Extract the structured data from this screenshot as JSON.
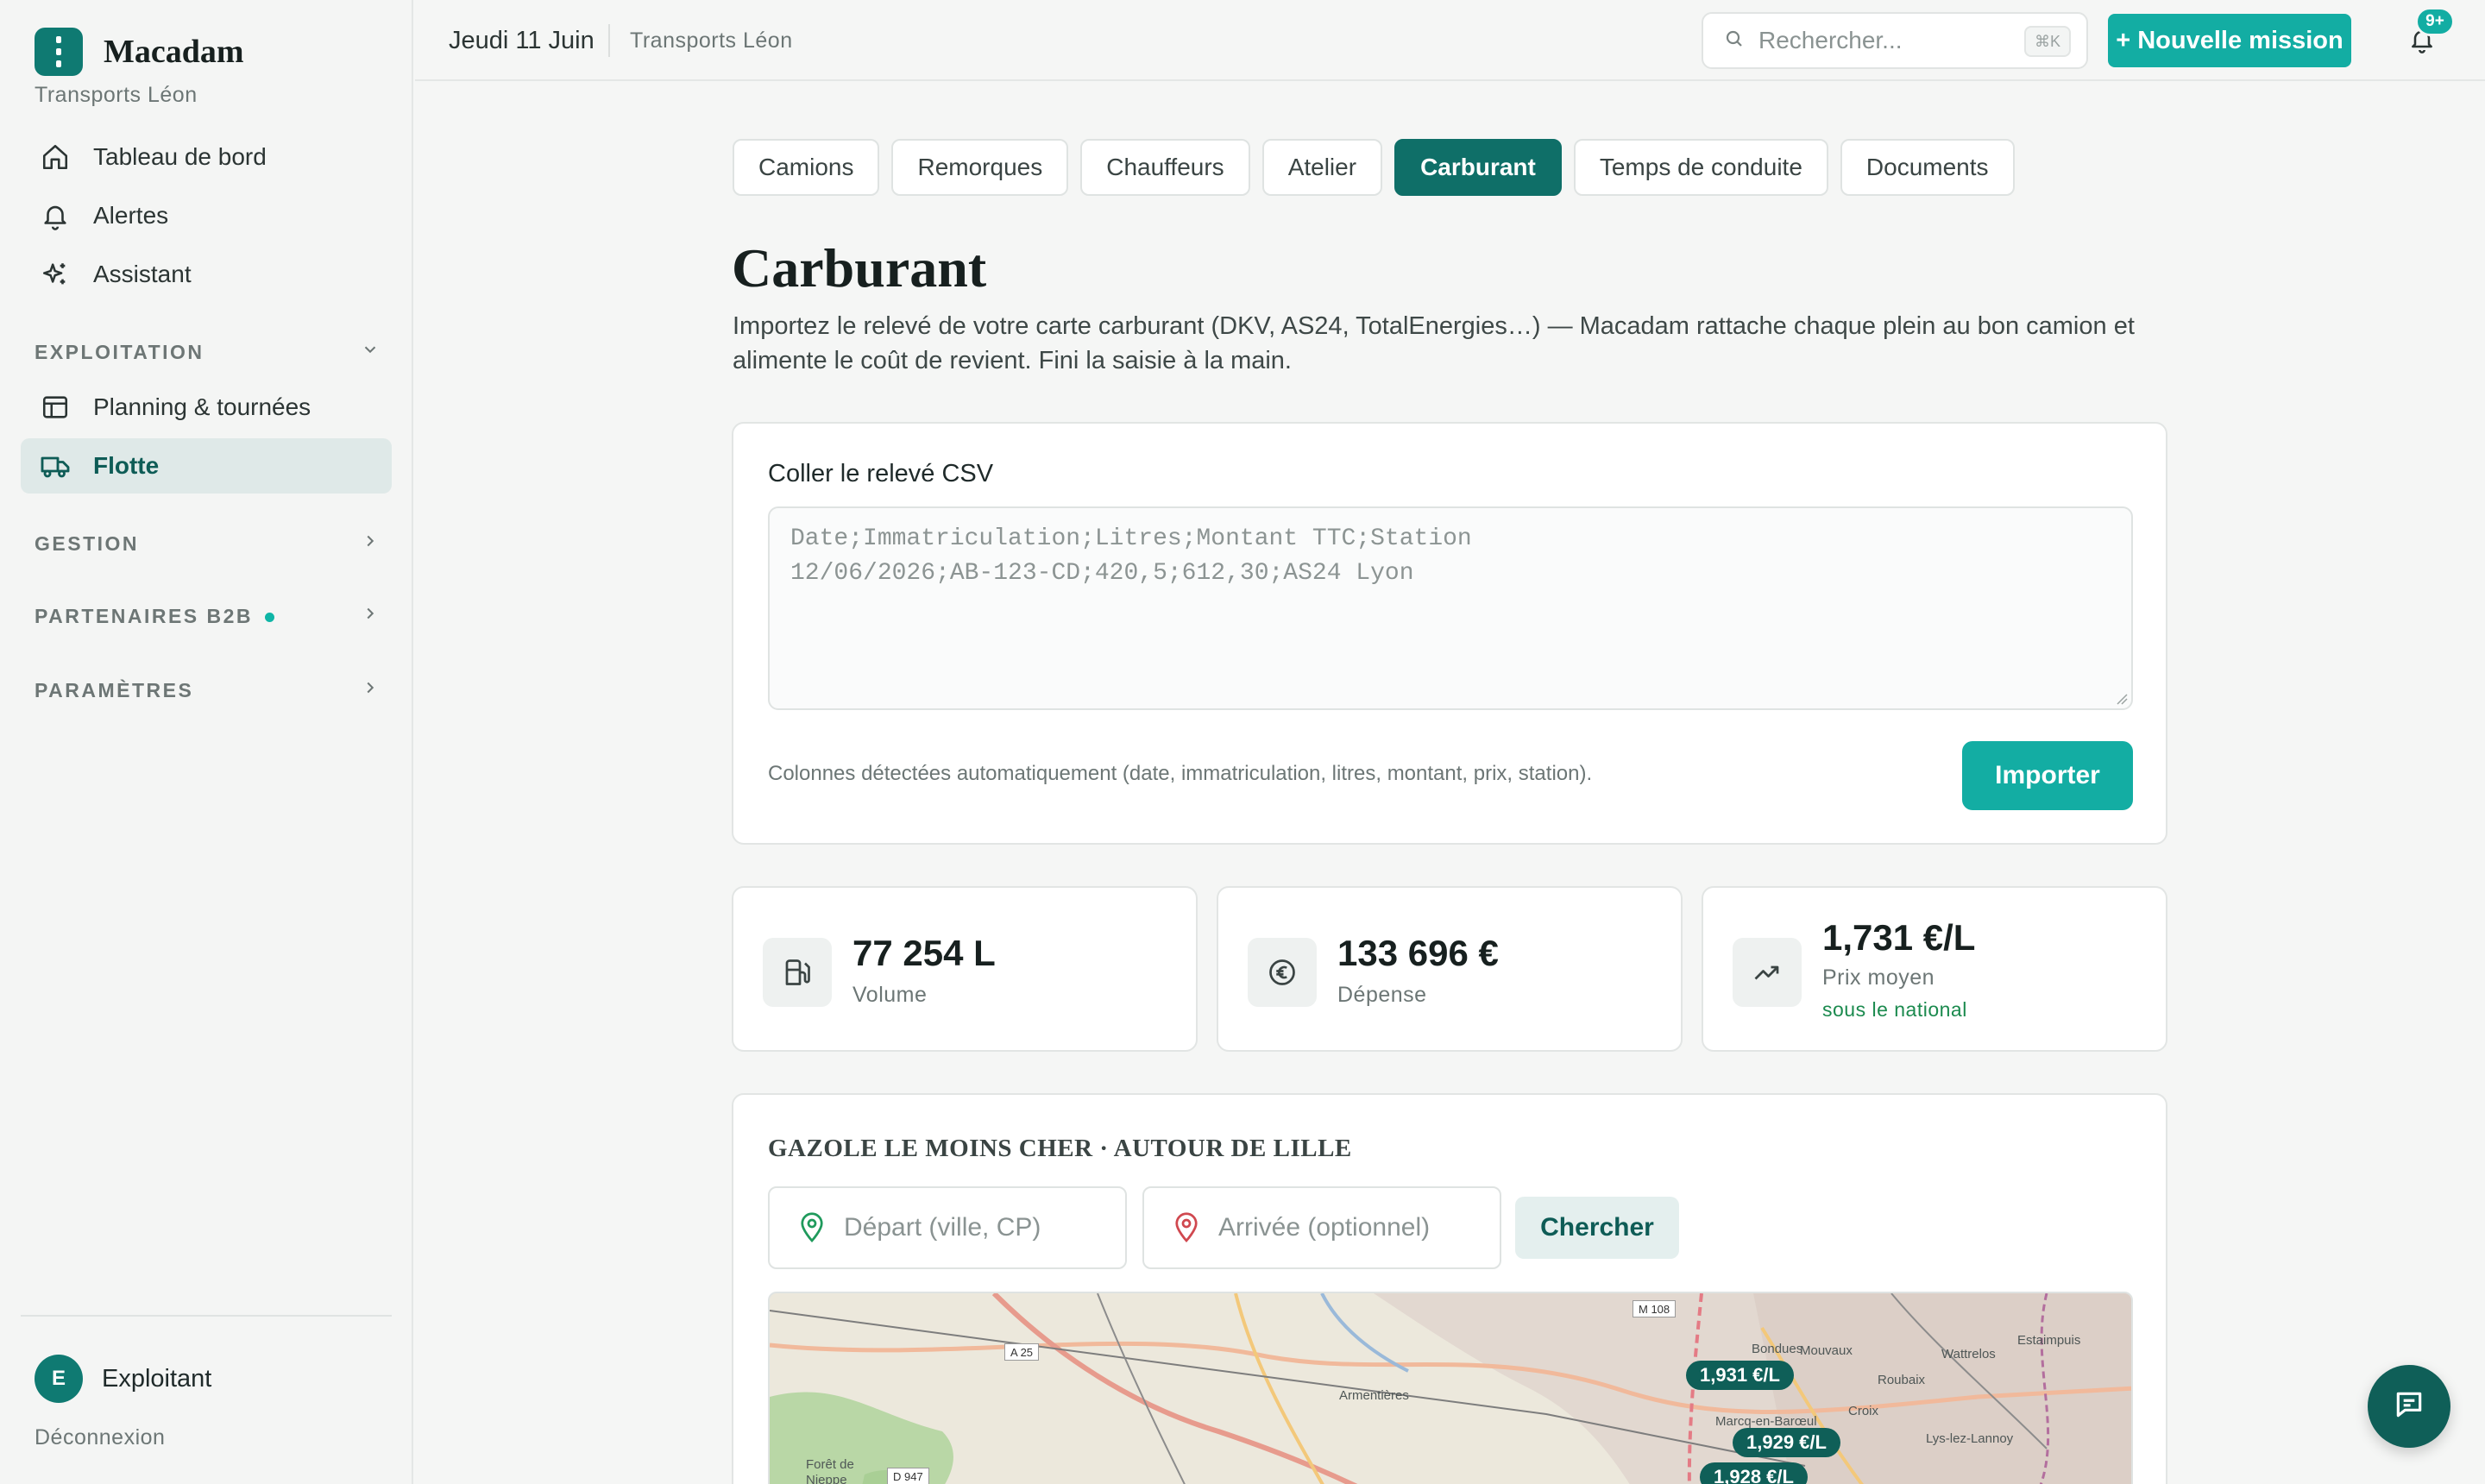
{
  "brand": {
    "name": "Macadam",
    "company": "Transports Léon"
  },
  "sidebar": {
    "top_items": [
      {
        "label": "Tableau de bord",
        "icon": "home-icon"
      },
      {
        "label": "Alertes",
        "icon": "bell-icon"
      },
      {
        "label": "Assistant",
        "icon": "sparkles-icon"
      }
    ],
    "sections": {
      "exploitation": "EXPLOITATION",
      "gestion": "GESTION",
      "partenaires": "PARTENAIRES B2B",
      "parametres": "PARAMÈTRES"
    },
    "exploitation_items": [
      {
        "label": "Planning & tournées",
        "icon": "calendar-icon"
      },
      {
        "label": "Flotte",
        "icon": "truck-icon",
        "active": true
      }
    ],
    "user": {
      "initial": "E",
      "name": "Exploitant"
    },
    "logout": "Déconnexion"
  },
  "topbar": {
    "date": "Jeudi 11 Juin",
    "company": "Transports Léon",
    "search_placeholder": "Rechercher...",
    "shortcut": "⌘K",
    "new_mission": "+ Nouvelle mission",
    "notif_count": "9+"
  },
  "tabs": [
    "Camions",
    "Remorques",
    "Chauffeurs",
    "Atelier",
    "Carburant",
    "Temps de conduite",
    "Documents"
  ],
  "active_tab": "Carburant",
  "page": {
    "title": "Carburant",
    "description": "Importez le relevé de votre carte carburant (DKV, AS24, TotalEnergies…) — Macadam rattache chaque plein au bon camion et alimente le coût de revient. Fini la saisie à la main."
  },
  "csv": {
    "label": "Coller le relevé CSV",
    "placeholder": "Date;Immatriculation;Litres;Montant TTC;Station\n12/06/2026;AB-123-CD;420,5;612,30;AS24 Lyon",
    "hint": "Colonnes détectées automatiquement (date, immatriculation, litres, montant, prix, station).",
    "import_label": "Importer"
  },
  "stats": {
    "volume": {
      "value": "77 254 L",
      "label": "Volume",
      "icon": "fuel-pump-icon"
    },
    "spend": {
      "value": "133 696 €",
      "label": "Dépense",
      "icon": "euro-icon"
    },
    "price": {
      "value": "1,731 €/L",
      "label": "Prix moyen",
      "note": "sous le national",
      "icon": "trend-icon"
    }
  },
  "gas": {
    "title": "GAZOLE LE MOINS CHER · AUTOUR DE LILLE",
    "from_placeholder": "Départ (ville, CP)",
    "to_placeholder": "Arrivée (optionnel)",
    "search_label": "Chercher",
    "prices": [
      "1,931 €/L",
      "1,929 €/L",
      "1,928 €/L"
    ],
    "map_labels": [
      "Bondues",
      "Mouvaux",
      "Wattrelos",
      "Estaimpuis",
      "Roubaix",
      "Croix",
      "Marcq-en-Barœul",
      "Lys-lez-Lannoy",
      "Armentières",
      "Forêt de Nieppe"
    ],
    "roads": [
      "M 108",
      "A 25",
      "D 947"
    ]
  },
  "colors": {
    "accent": "#13ada3",
    "dark_teal": "#0f6f68",
    "success": "#1b8a4e"
  }
}
